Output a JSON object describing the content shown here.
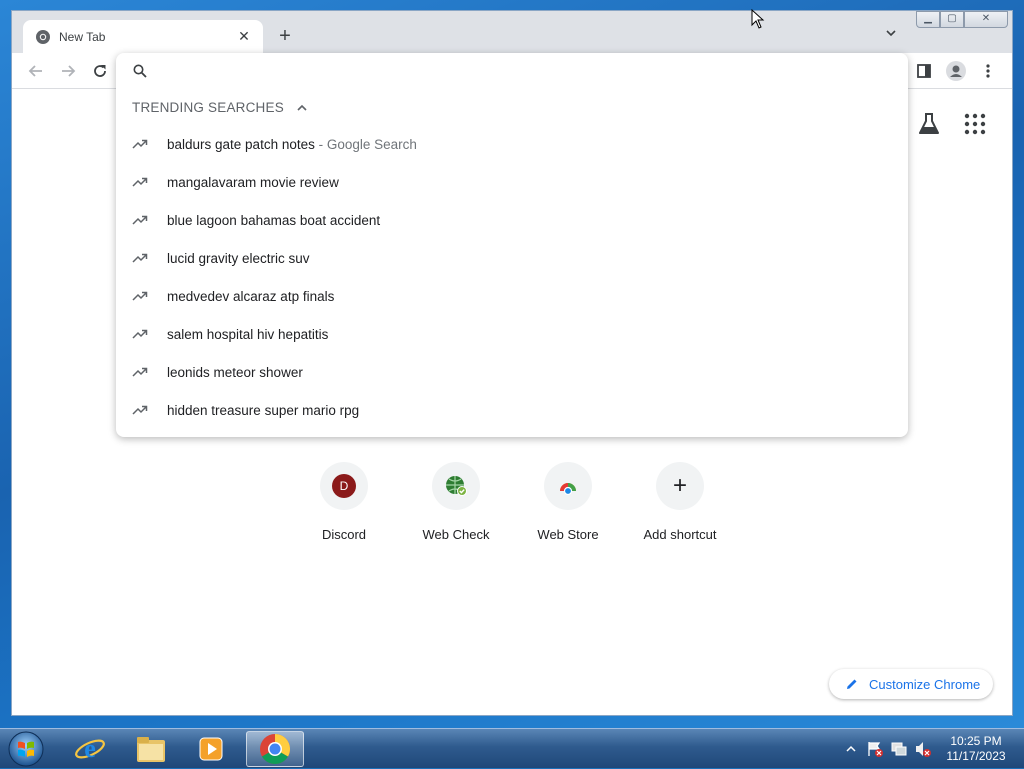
{
  "browser": {
    "tab": {
      "title": "New Tab",
      "close_glyph": "✕"
    },
    "new_tab_glyph": "+",
    "window_controls": {
      "minimize": "▁",
      "maximize": "▢",
      "close": "✕"
    }
  },
  "omnibox": {
    "value": "",
    "trending_header": "TRENDING SEARCHES",
    "suggestions": [
      {
        "text": "baldurs gate patch notes",
        "suffix": " - Google Search"
      },
      {
        "text": "mangalavaram movie review",
        "suffix": ""
      },
      {
        "text": "blue lagoon bahamas boat accident",
        "suffix": ""
      },
      {
        "text": "lucid gravity electric suv",
        "suffix": ""
      },
      {
        "text": "medvedev alcaraz atp finals",
        "suffix": ""
      },
      {
        "text": "salem hospital hiv hepatitis",
        "suffix": ""
      },
      {
        "text": "leonids meteor shower",
        "suffix": ""
      },
      {
        "text": "hidden treasure super mario rpg",
        "suffix": ""
      }
    ]
  },
  "shortcuts": [
    {
      "label": "Discord",
      "icon": "discord-icon",
      "letter": "D"
    },
    {
      "label": "Web Check",
      "icon": "web-check-icon"
    },
    {
      "label": "Web Store",
      "icon": "web-store-icon"
    },
    {
      "label": "Add shortcut",
      "icon": "plus-icon",
      "glyph": "+"
    }
  ],
  "customize_label": "Customize Chrome",
  "taskbar": {
    "time": "10:25 PM",
    "date": "11/17/2023"
  },
  "colors": {
    "accent_blue": "#1a73e8",
    "discord_red": "#8b1a1a",
    "tab_strip": "#dee1e6"
  }
}
